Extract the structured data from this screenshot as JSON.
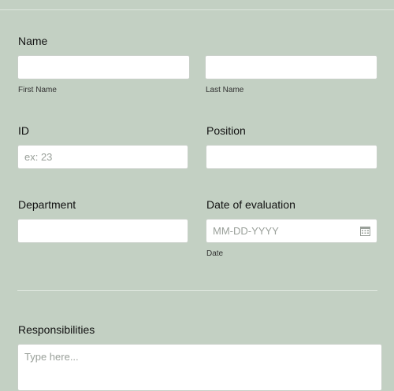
{
  "name": {
    "label": "Name",
    "first_sublabel": "First Name",
    "last_sublabel": "Last Name"
  },
  "id": {
    "label": "ID",
    "placeholder": "ex: 23"
  },
  "position": {
    "label": "Position"
  },
  "department": {
    "label": "Department"
  },
  "date_of_evaluation": {
    "label": "Date of evaluation",
    "placeholder": "MM-DD-YYYY",
    "sublabel": "Date"
  },
  "responsibilities": {
    "label": "Responsibilities",
    "placeholder": "Type here..."
  },
  "icons": {
    "date_picker": "calendar-icon"
  },
  "colors": {
    "background": "#c3d0c3",
    "field": "#ffffff"
  }
}
